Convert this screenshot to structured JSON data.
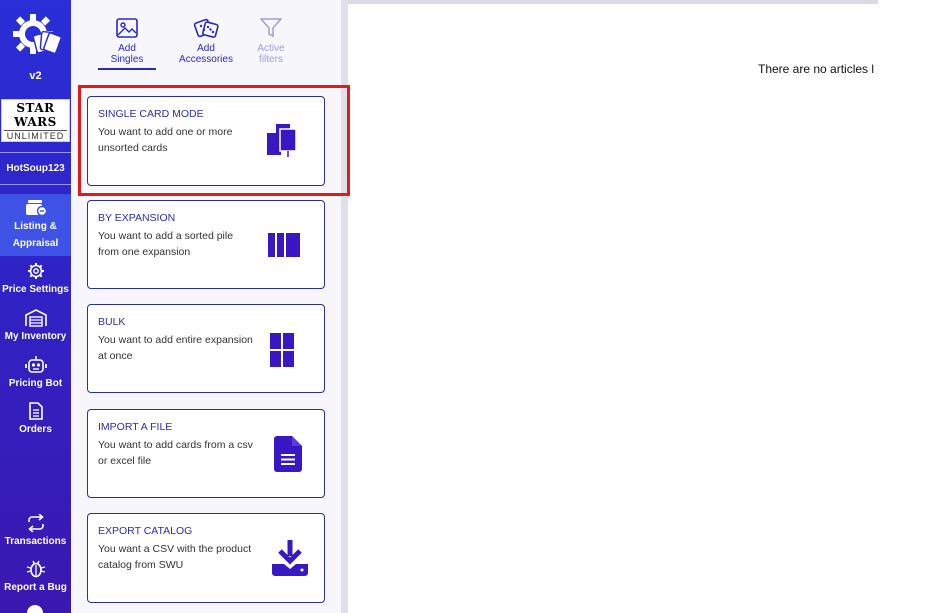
{
  "app": {
    "version": "v2"
  },
  "game": {
    "title_line1": "STAR",
    "title_line2": "WARS",
    "subtitle": "UNLIMITED"
  },
  "user": {
    "name": "HotSoup123"
  },
  "nav": {
    "items": [
      {
        "line1": "Listing &",
        "line2": "Appraisal",
        "icon": "listing-icon",
        "active": true
      },
      {
        "line1": "Price Settings",
        "icon": "gear-icon"
      },
      {
        "line1": "My Inventory",
        "icon": "warehouse-icon"
      },
      {
        "line1": "Pricing Bot",
        "icon": "robot-icon"
      },
      {
        "line1": "Orders",
        "icon": "document-icon"
      },
      {
        "line1": "Transactions",
        "icon": "transfer-icon"
      },
      {
        "line1": "Report a Bug",
        "icon": "bug-icon"
      }
    ]
  },
  "tabs": [
    {
      "line1": "Add",
      "line2": "Singles",
      "icon": "image-icon",
      "active": true
    },
    {
      "line1": "Add",
      "line2": "Accessories",
      "icon": "dice-icon"
    },
    {
      "line1": "Active",
      "line2": "filters",
      "icon": "filter-icon",
      "disabled": true
    }
  ],
  "modes": [
    {
      "title": "SINGLE CARD MODE",
      "desc": "You want to add one or more unsorted cards",
      "icon": "cards-stack-icon"
    },
    {
      "title": "BY EXPANSION",
      "desc": "You want to add a sorted pile from one expansion",
      "icon": "columns-icon"
    },
    {
      "title": "BULK",
      "desc": "You want to add entire expansion at once",
      "icon": "grid-icon"
    },
    {
      "title": "IMPORT A FILE",
      "desc": "You want to add cards from a csv or excel file",
      "icon": "file-icon"
    },
    {
      "title": "EXPORT CATALOG",
      "desc": "You want a CSV with the product catalog from SWU",
      "icon": "download-icon"
    }
  ],
  "content": {
    "empty_message": "There are no articles l"
  },
  "colors": {
    "nav_bg": "#2f24c7",
    "accent": "#2b2fa8",
    "icon": "#3a17c4",
    "highlight": "#e01b1b"
  }
}
